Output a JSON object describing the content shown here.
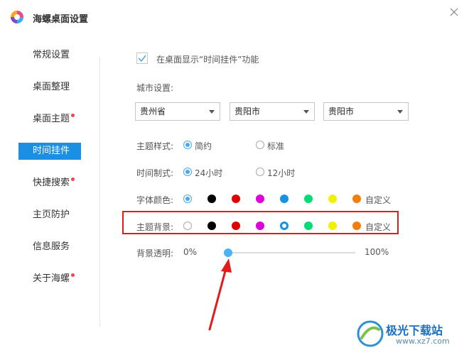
{
  "app": {
    "title": "海螺桌面设置"
  },
  "sidebar": {
    "items": [
      {
        "label": "常规设置",
        "dot": false,
        "active": false
      },
      {
        "label": "桌面整理",
        "dot": false,
        "active": false
      },
      {
        "label": "桌面主题",
        "dot": true,
        "active": false
      },
      {
        "label": "时间挂件",
        "dot": false,
        "active": true
      },
      {
        "label": "快捷搜索",
        "dot": true,
        "active": false
      },
      {
        "label": "主页防护",
        "dot": false,
        "active": false
      },
      {
        "label": "信息服务",
        "dot": false,
        "active": false
      },
      {
        "label": "关于海螺",
        "dot": true,
        "active": false
      }
    ]
  },
  "main": {
    "show_widget": {
      "label": "在桌面显示“时间挂件”功能",
      "checked": true
    },
    "city": {
      "label": "城市设置:",
      "province": "贵州省",
      "city": "贵阳市",
      "district": "贵阳市"
    },
    "theme_style": {
      "label": "主题样式:",
      "options": [
        "简约",
        "标准"
      ],
      "selected": 0
    },
    "time_format": {
      "label": "时间制式:",
      "options": [
        "24小时",
        "12小时"
      ],
      "selected": 0
    },
    "font_color": {
      "label": "字体颜色:",
      "colors": [
        "#ffffff",
        "#000000",
        "#e00000",
        "#dd00dd",
        "#1a90e0",
        "#00dd77",
        "#f0f000",
        "#f07f10"
      ],
      "selected": 0,
      "custom_label": "自定义"
    },
    "theme_bg": {
      "label": "主题背景:",
      "colors": [
        "#ffffff",
        "#000000",
        "#e00000",
        "#dd00dd",
        "#1a90e0",
        "#00dd77",
        "#f0f000",
        "#f07f10"
      ],
      "selected": 4,
      "custom_label": "自定义"
    },
    "bg_transparency": {
      "label": "背景透明:",
      "min_label": "0%",
      "max_label": "100%",
      "value": 0
    }
  },
  "watermark": {
    "text_cn": "极光下载站",
    "text_url": "www.xz7.com"
  },
  "accent": "#1a8fe3",
  "highlight_color": "#e21b1b"
}
